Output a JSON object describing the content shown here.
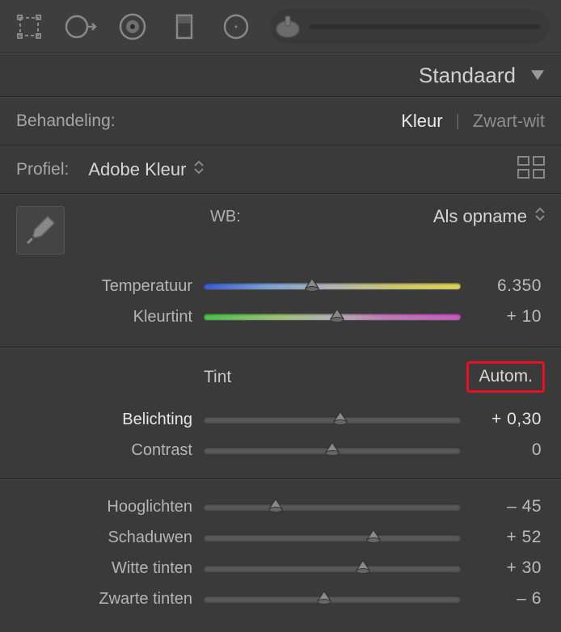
{
  "panel": {
    "title": "Standaard"
  },
  "treatment": {
    "label": "Behandeling:",
    "color": "Kleur",
    "bw": "Zwart-wit"
  },
  "profile": {
    "label": "Profiel:",
    "value": "Adobe Kleur"
  },
  "wb": {
    "label": "WB:",
    "value": "Als opname"
  },
  "sliders_wb": {
    "temp": {
      "label": "Temperatuur",
      "value": "6.350",
      "pos": 42
    },
    "tint": {
      "label": "Kleurtint",
      "value": "+ 10",
      "pos": 52
    }
  },
  "tone": {
    "heading": "Tint",
    "auto": "Autom."
  },
  "sliders_tone": {
    "exposure": {
      "label": "Belichting",
      "value": "+ 0,30",
      "pos": 53,
      "bright": true
    },
    "contrast": {
      "label": "Contrast",
      "value": "0",
      "pos": 50
    }
  },
  "sliders_detail": {
    "highlights": {
      "label": "Hooglichten",
      "value": "– 45",
      "pos": 28
    },
    "shadows": {
      "label": "Schaduwen",
      "value": "+ 52",
      "pos": 66
    },
    "whites": {
      "label": "Witte tinten",
      "value": "+ 30",
      "pos": 62
    },
    "blacks": {
      "label": "Zwarte tinten",
      "value": "– 6",
      "pos": 47
    }
  }
}
